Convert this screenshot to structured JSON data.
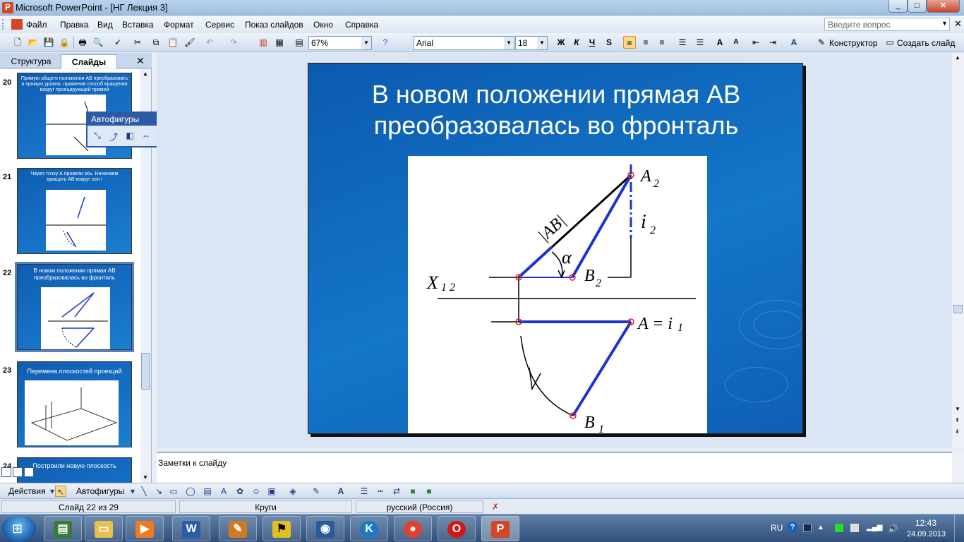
{
  "window": {
    "title": "Microsoft PowerPoint - [НГ Лекция 3]",
    "min": "_",
    "max": "□",
    "close": "✕"
  },
  "menu": {
    "items": [
      "Файл",
      "Правка",
      "Вид",
      "Вставка",
      "Формат",
      "Сервис",
      "Показ слайдов",
      "Окно",
      "Справка"
    ],
    "help_placeholder": "Введите вопрос"
  },
  "toolbar": {
    "zoom": "67%",
    "font": "Arial",
    "font_size": "18",
    "bold": "Ж",
    "italic": "К",
    "underline": "Ч",
    "shadow": "S",
    "designer": "Конструктор",
    "new_slide": "Создать слайд"
  },
  "left_pane": {
    "tab_outline": "Структура",
    "tab_slides": "Слайды",
    "close": "✕",
    "slides": [
      {
        "num": "20",
        "title": "Прямую общего положения АВ преобразовать в прямую уровня, применив способ вращения вокруг проецирующей прямой"
      },
      {
        "num": "21",
        "title": "Через точку А провели ось. Начинаем вращать АВ вокруг оси i"
      },
      {
        "num": "22",
        "title": "В новом положении прямая АВ преобразовалась во фронталь"
      },
      {
        "num": "23",
        "title": "Перемена плоскостей проекций"
      },
      {
        "num": "24",
        "title": "Построили новую плоскость"
      }
    ]
  },
  "autoshapes": {
    "title": "Автофигуры",
    "dropdown": "▼",
    "close": "✕"
  },
  "slide": {
    "title": "В новом положении прямая АВ преобразовалась во фронталь",
    "labels": {
      "a2": "A",
      "a2_sub": "2",
      "i2": "i",
      "i2_sub": "2",
      "ab": "|AB|",
      "alpha": "α",
      "b2": "B",
      "b2_sub": "2",
      "x12": "X",
      "x12_sub": "1 2",
      "a_i1": "A = i",
      "a_i1_sub": "1",
      "b1": "B",
      "b1_sub": "1"
    }
  },
  "notes": {
    "text": "Заметки к слайду"
  },
  "drawbar": {
    "actions": "Действия",
    "autoshapes": "Автофигуры"
  },
  "status": {
    "slide": "Слайд 22 из 29",
    "design": "Круги",
    "language": "русский (Россия)"
  },
  "taskbar": {
    "lang": "RU",
    "help": "?",
    "time": "12:43",
    "date": "24.09.2013"
  }
}
